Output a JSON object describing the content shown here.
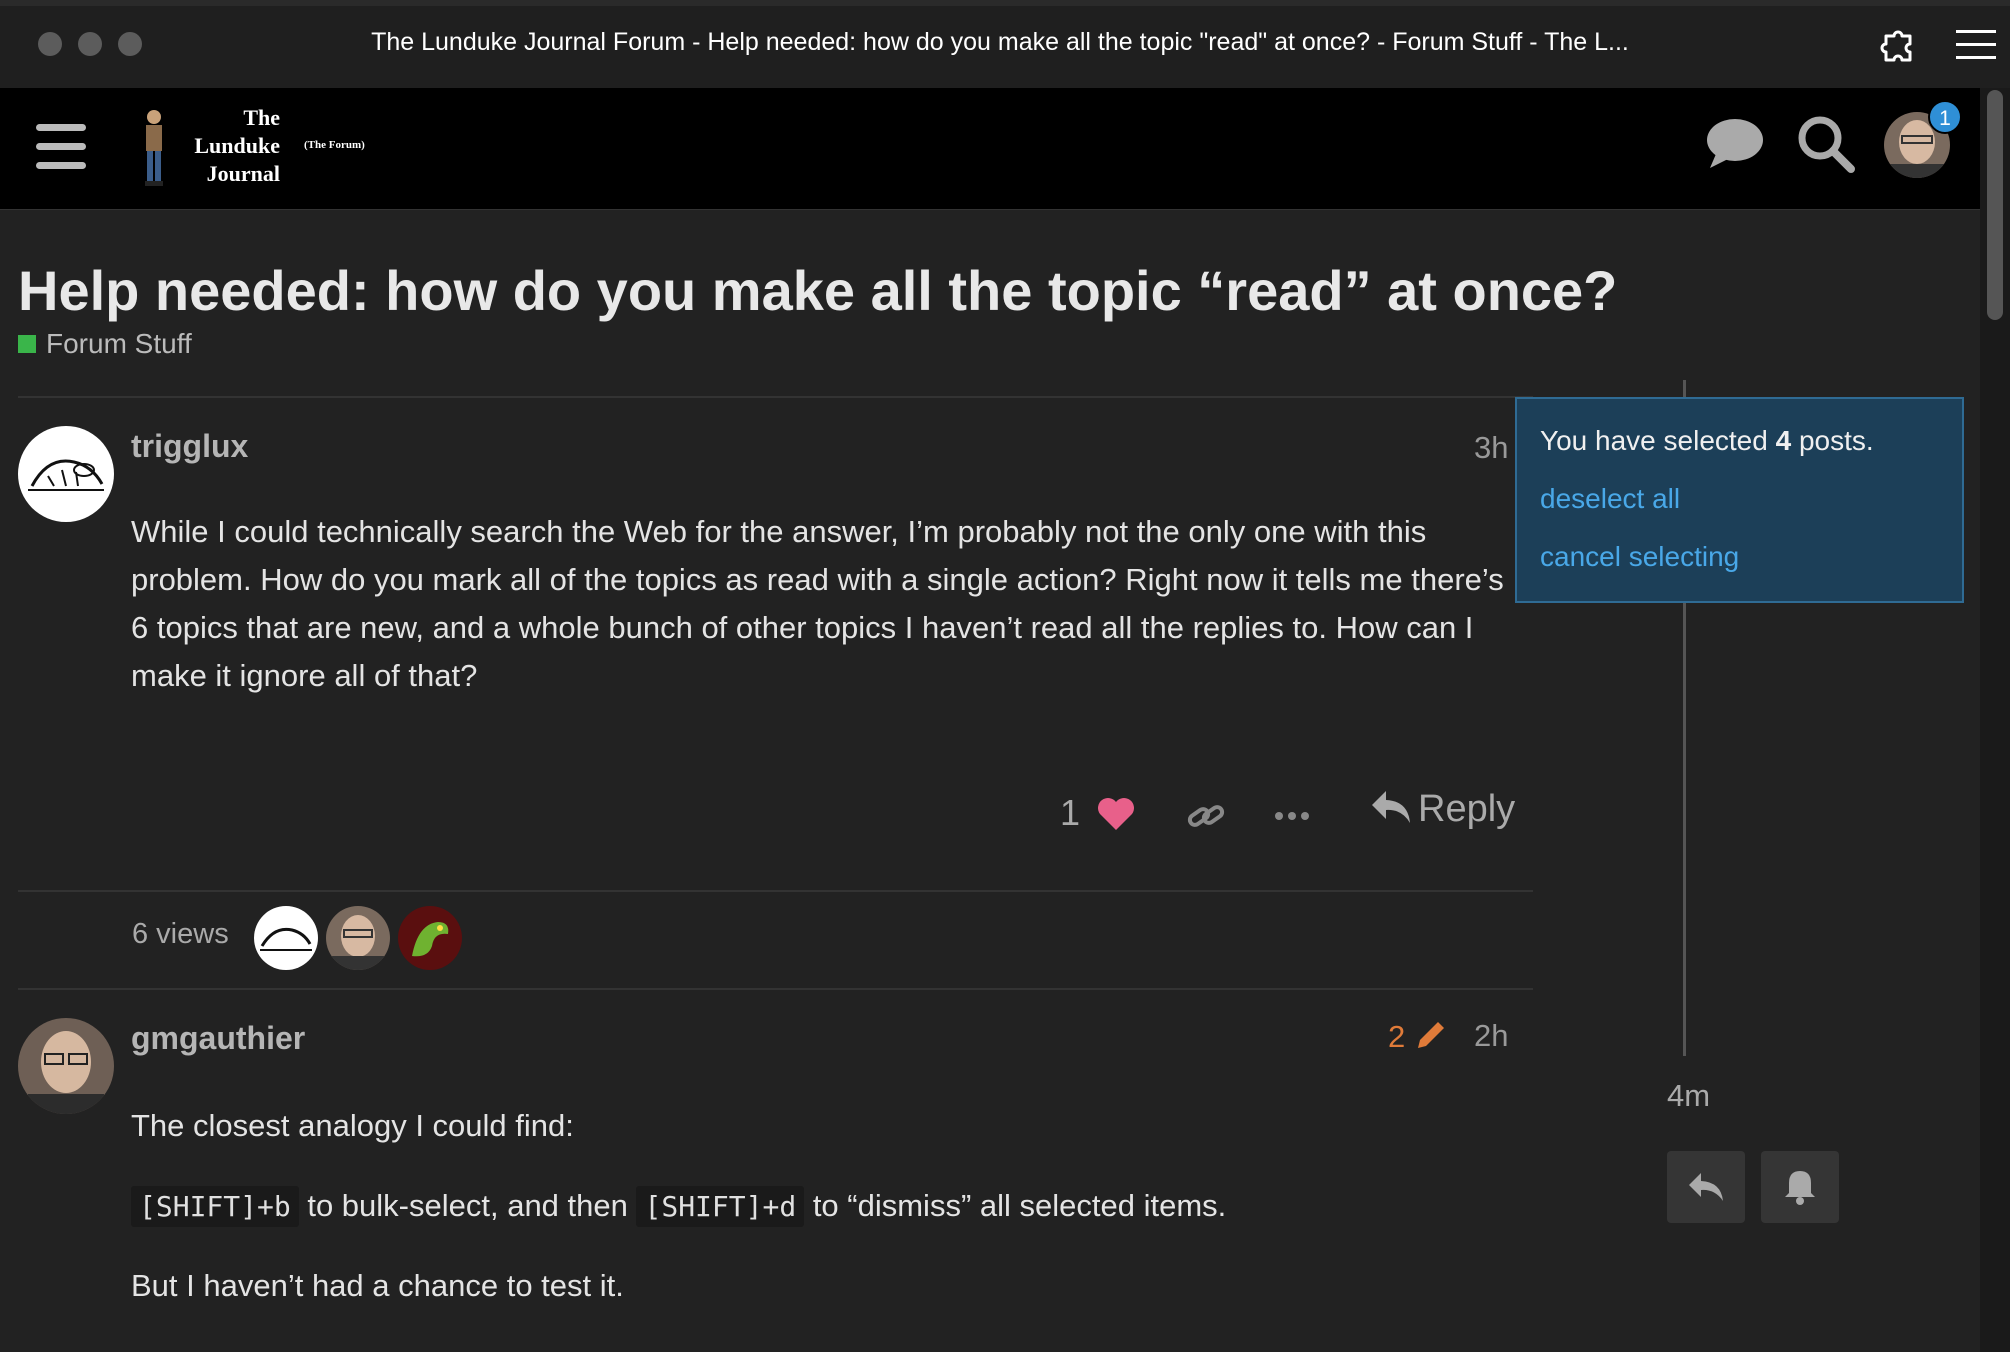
{
  "window": {
    "title": "The Lunduke Journal Forum - Help needed: how do you make all the topic \"read\" at once? - Forum Stuff - The L..."
  },
  "header": {
    "logo_lines": [
      "The",
      "Lunduke",
      "Journal"
    ],
    "logo_sub": "(The Forum)",
    "notification_count": "1"
  },
  "topic": {
    "title": "Help needed: how do you make all the topic “read” at once?",
    "category": "Forum Stuff",
    "category_color": "#3ab54a"
  },
  "posts": [
    {
      "username": "trigglux",
      "time": "3h",
      "body": "While I could technically search the Web for the answer, I’m probably not the only one with this problem. How do you mark all of the topics as read with a single action? Right now it tells me there’s 6 topics that are new, and a whole bunch of other topics I haven’t read all the replies to. How can I make it ignore all of that?",
      "likes": "1",
      "reply_label": "Reply",
      "views": "6 views"
    },
    {
      "username": "gmgauthier",
      "time": "2h",
      "edit_count": "2",
      "p1": "The closest analogy I could find:",
      "key1": "[SHIFT]+b",
      "mid": " to bulk-select, and then ",
      "key2": "[SHIFT]+d",
      "end": " to “dismiss” all selected items.",
      "p3": "But I haven’t had a chance to test it."
    }
  ],
  "selection": {
    "prefix": "You have selected ",
    "count": "4",
    "suffix": " posts.",
    "deselect_all": "deselect all",
    "cancel_selecting": "cancel selecting"
  },
  "timeline": {
    "time": "4m"
  },
  "colors": {
    "accent_link": "#49a8e8",
    "like_heart": "#e8608a",
    "edit_orange": "#e07b39",
    "notification": "#2f8fd6"
  }
}
